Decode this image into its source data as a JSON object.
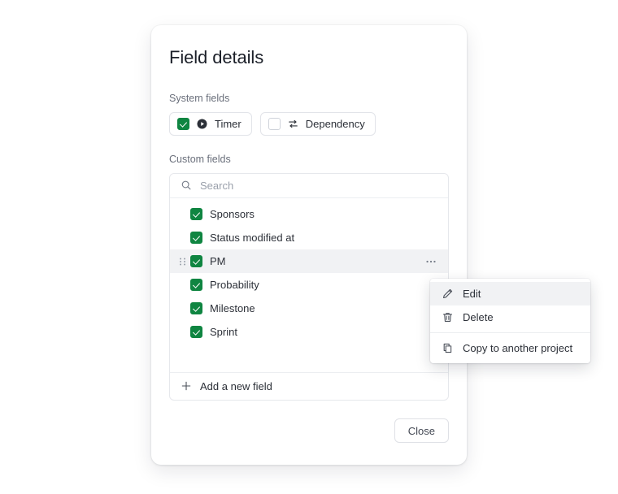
{
  "dialog": {
    "title": "Field details"
  },
  "system_fields": {
    "label": "System fields",
    "items": [
      {
        "label": "Timer",
        "checked": true,
        "icon": "play-circle-icon"
      },
      {
        "label": "Dependency",
        "checked": false,
        "icon": "swap-arrows-icon"
      }
    ]
  },
  "custom_fields": {
    "label": "Custom fields",
    "search": {
      "placeholder": "Search",
      "value": "",
      "icon": "search-icon"
    },
    "items": [
      {
        "label": "Sponsors",
        "checked": true,
        "active": false
      },
      {
        "label": "Status modified at",
        "checked": true,
        "active": false
      },
      {
        "label": "PM",
        "checked": true,
        "active": true
      },
      {
        "label": "Probability",
        "checked": true,
        "active": false
      },
      {
        "label": "Milestone",
        "checked": true,
        "active": false
      },
      {
        "label": "Sprint",
        "checked": true,
        "active": false
      }
    ],
    "add_field": {
      "label": "Add a new field",
      "icon": "plus-icon"
    }
  },
  "context_menu": {
    "items": [
      {
        "label": "Edit",
        "icon": "pencil-icon",
        "highlighted": true
      },
      {
        "label": "Delete",
        "icon": "trash-icon",
        "highlighted": false
      },
      {
        "label": "Copy to another project",
        "icon": "copy-icon",
        "highlighted": false
      }
    ]
  },
  "footer": {
    "close_label": "Close"
  },
  "colors": {
    "accent_green": "#0f8541",
    "text_primary": "#2c3038",
    "text_muted": "#6a6f7b",
    "border": "#e6e8ec",
    "row_active": "#f1f2f4"
  }
}
